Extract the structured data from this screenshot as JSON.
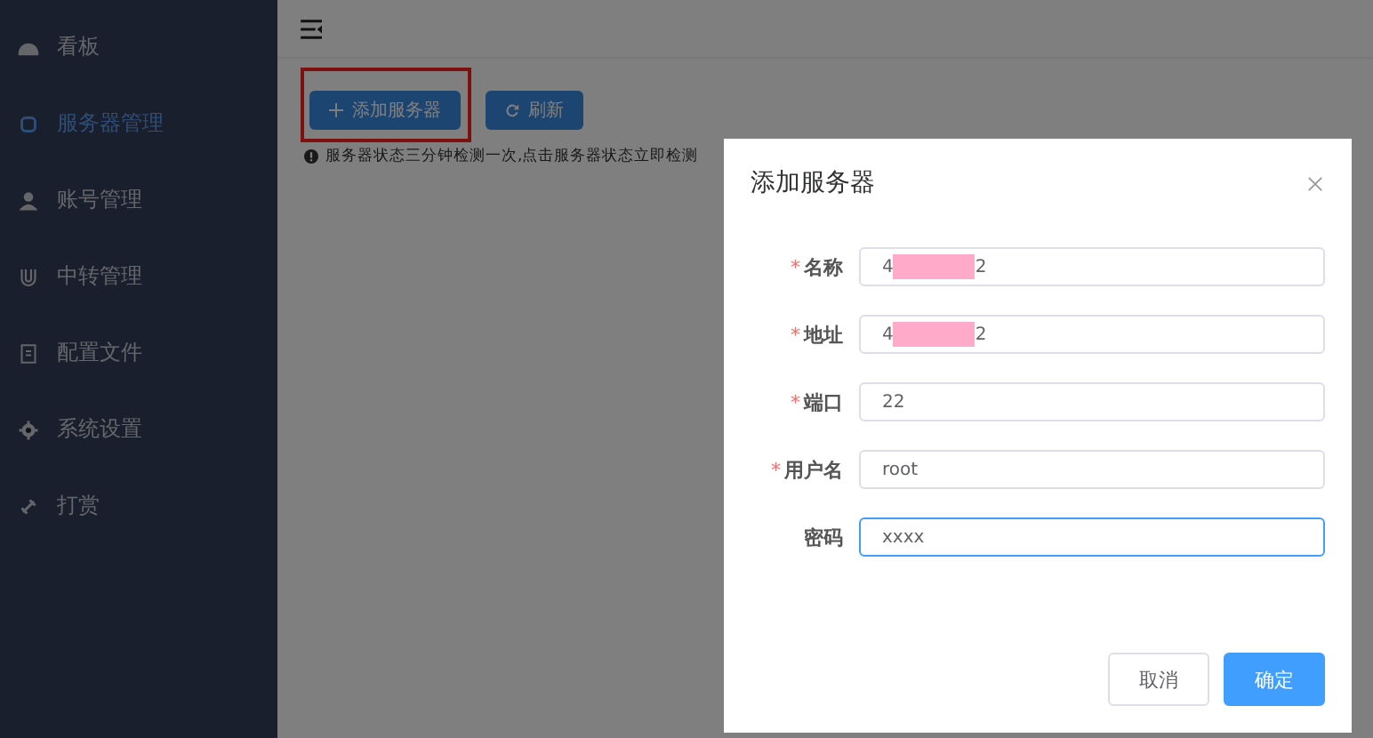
{
  "sidebar": {
    "items": [
      {
        "label": "看板",
        "selected": false
      },
      {
        "label": "服务器管理",
        "selected": true
      },
      {
        "label": "账号管理",
        "selected": false
      },
      {
        "label": "中转管理",
        "selected": false
      },
      {
        "label": "配置文件",
        "selected": false
      },
      {
        "label": "系统设置",
        "selected": false
      },
      {
        "label": "打赏",
        "selected": false
      }
    ]
  },
  "toolbar": {
    "buttons": [
      {
        "label": "添加服务器",
        "highlighted": true
      },
      {
        "label": "刷新",
        "highlighted": false
      }
    ],
    "notice": "服务器状态三分钟检测一次,点击服务器状态立即检测"
  },
  "dialog": {
    "title": "添加服务器",
    "fields": [
      {
        "label": "名称",
        "required_mark": "*",
        "value_start": "4",
        "redacted": true,
        "value_end": "2",
        "focused": false
      },
      {
        "label": "地址",
        "required_mark": "*",
        "value_start": "4",
        "redacted": true,
        "value_end": "2",
        "focused": false
      },
      {
        "label": "端口",
        "required_mark": "*",
        "value_start": "22",
        "redacted": false,
        "focused": false
      },
      {
        "label": "用户名",
        "required_mark": "*",
        "value_start": "root",
        "redacted": false,
        "focused": false
      },
      {
        "label": "密码",
        "value_start": "xxxx",
        "redacted": false,
        "focused": true
      }
    ],
    "buttons": [
      {
        "label": "取消",
        "kind": "secondary"
      },
      {
        "label": "确定",
        "kind": "primary"
      }
    ]
  }
}
